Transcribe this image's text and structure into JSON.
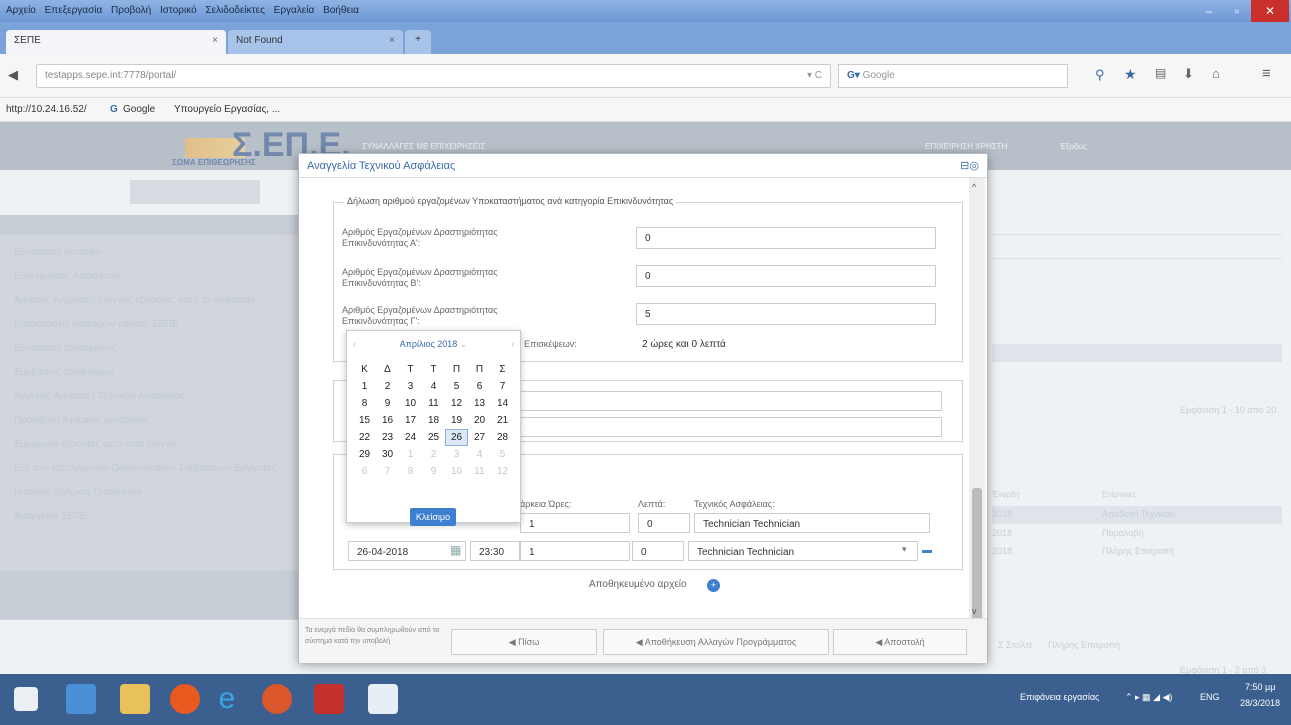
{
  "browser": {
    "menu": [
      "Αρχείο",
      "Επεξεργασία",
      "Προβολή",
      "Ιστορικό",
      "Σελιδοδείκτες",
      "Εργαλεία",
      "Βοήθεια"
    ],
    "tabs": [
      {
        "label": "ΣΕΠΕ"
      },
      {
        "label": "Not Found"
      }
    ],
    "url": "testapps.sepe.int:7778/portal/",
    "search_placeholder": "Google",
    "bookmarks": [
      "http://10.24.16.52/",
      "Google",
      "Υπουργείο Εργασίας, ..."
    ]
  },
  "site": {
    "logo_text": "Σ.ΕΠ.Ε.",
    "logo_sub": "ΣΩΜΑ ΕΠΙΘΕΩΡΗΣΗΣ",
    "header_center": "ΣΥΝΑΛΛΑΓΕΣ ΜΕ ΕΠΙΧΕΙΡΗΣΕΙΣ",
    "user": "ΕΠΙΧΕΙΡΗΣΗ ΧΡΗΣΤΗ",
    "logout": "Έξοδος",
    "sidebar_items": [
      "Εργασιακό Ιστορικό",
      "Επιχειρήσεις Ασφάλισης",
      "Αιτήσεις εγγραφής έλεγχος εργασίας κατά το Κεφάλαιο",
      "Καταστάσεις εισφορών μέλους ΣΕΠΕ",
      "Εργασιακό Διαφημίσεις",
      "Συμβάσεις Διαθεσίμων",
      "Αγγελίες Αιτήσεις / Τεχνικού Ασφάλειας",
      "Προσθήκη Ατομικής μεταβολής",
      "Συμφωνία εξουσίας μετά από έλεγχο",
      "Επί των Καταγγελιών Οικογενειακών Συμβάσεων Εργασίας",
      "Ιστορικό Δήλωση Τρανσιέντο",
      "Αναγγελία ΣΕΠΕ"
    ],
    "right_pager": "Εμφάνιση 1 - 10 από 20",
    "right_col_headers": [
      "Έναρξη",
      "Ενέργειες"
    ],
    "right_rows": [
      {
        "date": "2018",
        "action": "Αποδοχή Τεχνικού"
      },
      {
        "date": "2018",
        "action": "Παραλαβή"
      },
      {
        "date": "2018",
        "action": "Πλήρης Επιτροπή"
      }
    ],
    "bottom_links": [
      "Σ Στείλτε",
      "Πλήρης Επιτροπή"
    ],
    "bottom_pager": "Εμφάνιση 1 - 3 από 3"
  },
  "modal": {
    "title": "Αναγγελία Τεχνικού Ασφάλειας",
    "section_legend": "Δήλωση αριθμού εργαζομένων Υποκαταστήματος ανά κατηγορία Επικινδυνότητας",
    "rows": [
      {
        "label": "Αριθμός Εργαζομένων Δραστηριότητας Επικινδυνότητας Α':",
        "value": "0"
      },
      {
        "label": "Αριθμός Εργαζομένων Δραστηριότητας Επικινδυνότητας Β':",
        "value": "0"
      },
      {
        "label": "Αριθμός Εργαζομένων Δραστηριότητας Επικινδυνότητας Γ':",
        "value": "5"
      }
    ],
    "visit_label": "Επισκέψεων:",
    "visit_value": "2 ώρες και 0 λεπτά",
    "schedule_headers": {
      "hours": "Διάρκεια Ώρες:",
      "minutes": "Λεπτά:",
      "technician": "Τεχνικός Ασφάλειας:"
    },
    "schedule_rows": [
      {
        "date": "",
        "time": "",
        "hours": "1",
        "minutes": "0",
        "technician": "Technician Technician"
      },
      {
        "date": "26-04-2018",
        "time": "23:30",
        "hours": "1",
        "minutes": "0",
        "technician": "Technician Technician"
      }
    ],
    "attachment_label": "Αποθηκευμένο αρχείο",
    "footer_note": "Τα ενεργά πεδία θα συμπληρωθούν από το σύστημα κατά την υποβολή",
    "buttons": {
      "back": "Πίσω",
      "save_other": "Αποθήκευση Αλλαγών Προγράμματος",
      "submit": "Αποστολή"
    }
  },
  "calendar": {
    "month_label": "Απρίλιος 2018",
    "weekdays": [
      "Κ",
      "Δ",
      "Τ",
      "Τ",
      "Π",
      "Π",
      "Σ"
    ],
    "weeks": [
      [
        "1",
        "2",
        "3",
        "4",
        "5",
        "6",
        "7"
      ],
      [
        "8",
        "9",
        "10",
        "11",
        "12",
        "13",
        "14"
      ],
      [
        "15",
        "16",
        "17",
        "18",
        "19",
        "20",
        "21"
      ],
      [
        "22",
        "23",
        "24",
        "25",
        "26",
        "27",
        "28"
      ],
      [
        "29",
        "30",
        "1",
        "2",
        "3",
        "4",
        "5"
      ],
      [
        "6",
        "7",
        "8",
        "9",
        "10",
        "11",
        "12"
      ]
    ],
    "selected": "26",
    "close_label": "Κλείσιμο"
  },
  "taskbar": {
    "tray_text": "Επιφάνεια εργασίας",
    "lang": "ENG",
    "time": "7:50 μμ",
    "date": "28/3/2018"
  }
}
